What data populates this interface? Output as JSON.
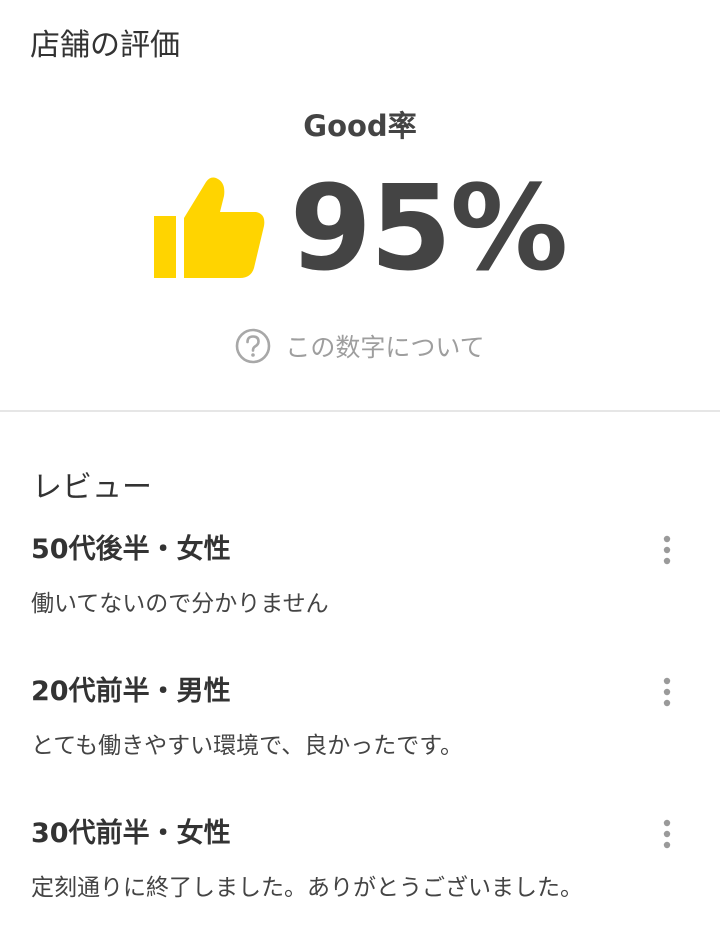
{
  "store_rating": {
    "title": "店舗の評価",
    "rate_label": "Good率",
    "rate_value": "95%",
    "rate_percent": 95,
    "about_link": "この数字について",
    "accent_color": "#FFD400",
    "icons": {
      "thumb": "thumbs-up-icon",
      "help": "question-circle-icon"
    }
  },
  "reviews": {
    "title": "レビュー",
    "items": [
      {
        "author": "50代後半・女性",
        "text": "働いてないので分かりません"
      },
      {
        "author": "20代前半・男性",
        "text": "とても働きやすい環境で、良かったです。"
      },
      {
        "author": "30代前半・女性",
        "text": "定刻通りに終了しました。ありがとうございました。"
      }
    ],
    "more_icon": "more-vertical-icon"
  }
}
